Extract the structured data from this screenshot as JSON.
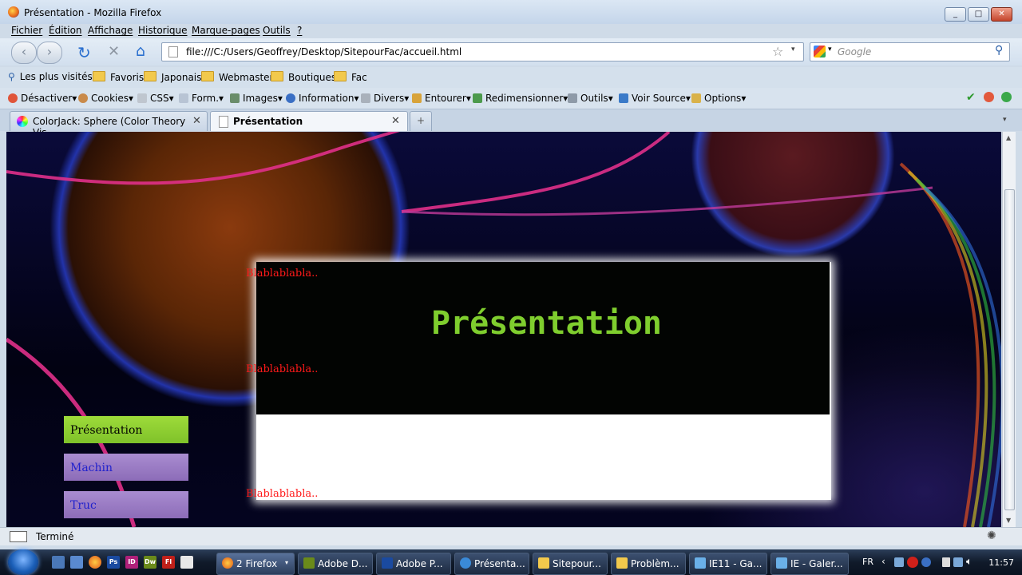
{
  "window": {
    "title": "Présentation - Mozilla Firefox",
    "min": "_",
    "max": "□",
    "close": "✕"
  },
  "menu": [
    "Fichier",
    "Édition",
    "Affichage",
    "Historique",
    "Marque-pages",
    "Outils",
    "?"
  ],
  "nav": {
    "url": "file:///C:/Users/Geoffrey/Desktop/SitepourFac/accueil.html",
    "search_placeholder": "Google"
  },
  "bookmarks": [
    "Les plus visités",
    "Favoris",
    "Japonais",
    "Webmaster",
    "Boutiques",
    "Fac"
  ],
  "devtools": [
    "Désactiver",
    "Cookies",
    "CSS",
    "Form.",
    "Images",
    "Information",
    "Divers",
    "Entourer",
    "Redimensionner",
    "Outils",
    "Voir Source",
    "Options"
  ],
  "tabs": [
    {
      "label": "ColorJack: Sphere (Color Theory Vis...",
      "close": "✕"
    },
    {
      "label": "Présentation",
      "close": "✕"
    }
  ],
  "new_tab": "+",
  "page": {
    "heading": "Présentation",
    "bla": [
      "Blablablabla..",
      "Blablablabla..",
      "Blablablabla.."
    ],
    "menu": [
      {
        "label": "Présentation",
        "color": "#8fd12a",
        "text": "#000000"
      },
      {
        "label": "Machin",
        "color": "#9a7bc4",
        "text": "#2222cc"
      },
      {
        "label": "Truc",
        "color": "#9a7bc4",
        "text": "#2222cc"
      }
    ]
  },
  "status": "Terminé",
  "taskbar": {
    "buttons": [
      "2 Firefox",
      "Adobe D...",
      "Adobe P...",
      "Présenta...",
      "Sitepour...",
      "Problèm...",
      "IE11 - Ga...",
      "IE - Galer..."
    ],
    "quick_launch": [
      "Ps",
      "ID",
      "Dw",
      "Fl"
    ],
    "language": "FR",
    "clock": "11:57"
  },
  "colors": {
    "heading": "#7fce2e",
    "bla": "#ff1a1a"
  }
}
